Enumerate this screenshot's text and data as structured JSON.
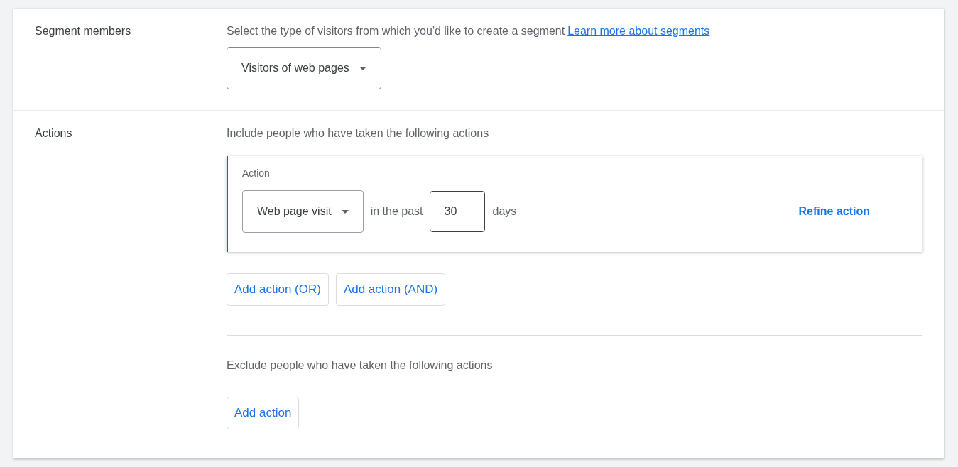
{
  "segment_members": {
    "label": "Segment members",
    "description": "Select the type of visitors from which you'd like to create a segment",
    "link": "Learn more about segments",
    "dropdown": "Visitors of web pages"
  },
  "actions": {
    "label": "Actions",
    "include_text": "Include people who have taken the following actions",
    "action_card": {
      "title": "Action",
      "type_dropdown": "Web page visit",
      "before_input": "in the past",
      "days_value": "30",
      "after_input": "days",
      "refine_link": "Refine action"
    },
    "include_buttons": [
      "Add action (OR)",
      "Add action (AND)"
    ],
    "exclude_text": "Exclude people who have taken the following actions",
    "exclude_buttons": [
      "Add action"
    ]
  }
}
